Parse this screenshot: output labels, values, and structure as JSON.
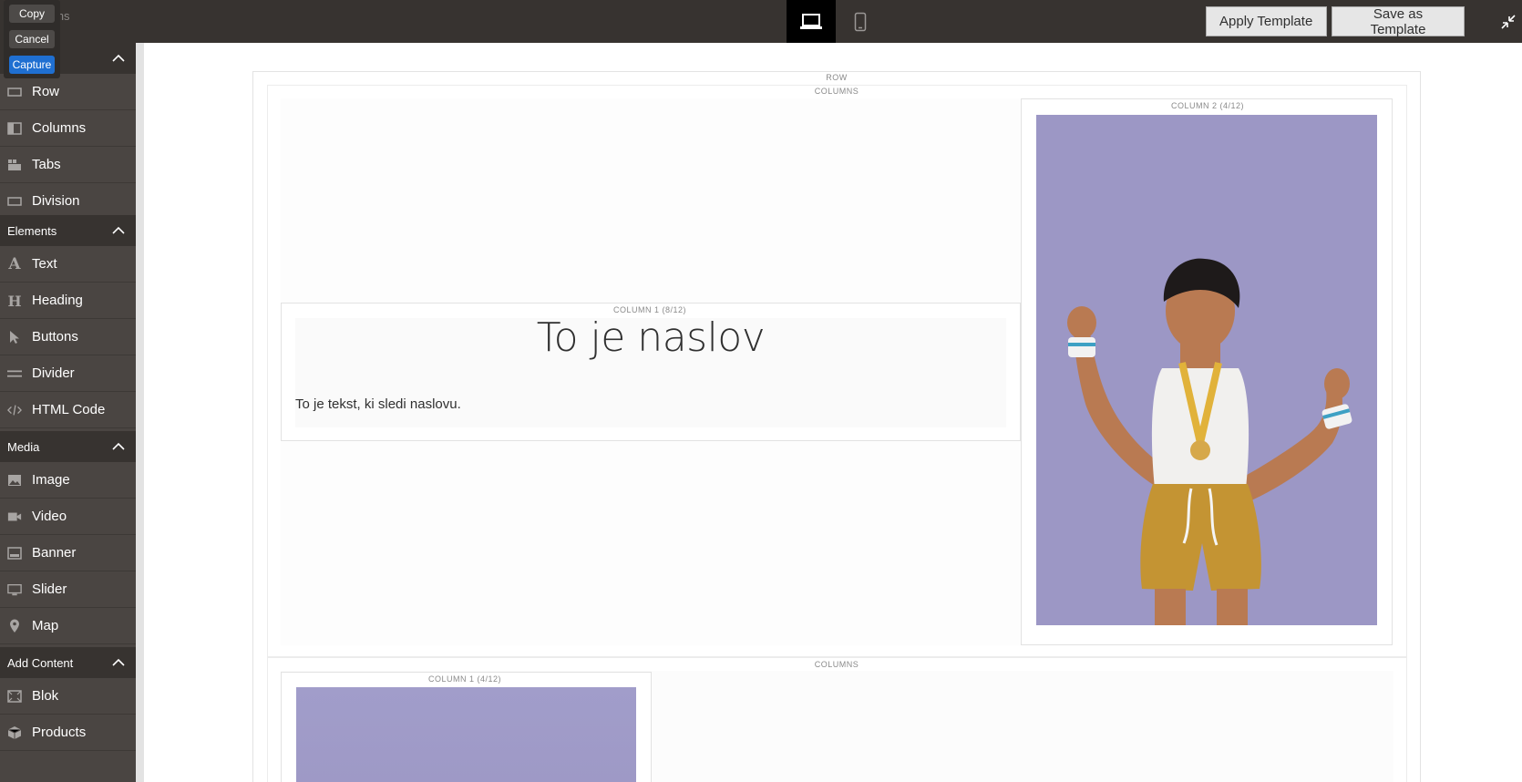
{
  "toolbar": {
    "apply_template": "Apply Template",
    "save_as_template": "Save as Template"
  },
  "capture_widget": {
    "copy": "Copy",
    "cancel": "Cancel",
    "capture": "Capture"
  },
  "sidebar": {
    "search_hint": "ems",
    "groups": [
      {
        "label": ""
      },
      {
        "label": "Elements"
      },
      {
        "label": "Media"
      },
      {
        "label": "Add Content"
      }
    ],
    "layout_items": [
      "Row",
      "Columns",
      "Tabs",
      "Division"
    ],
    "element_items": [
      "Text",
      "Heading",
      "Buttons",
      "Divider",
      "HTML Code"
    ],
    "media_items": [
      "Image",
      "Video",
      "Banner",
      "Slider",
      "Map"
    ],
    "content_items": [
      "Blok",
      "Products"
    ]
  },
  "stage": {
    "row_label": "ROW",
    "columns_label": "COLUMNS",
    "column2_label": "COLUMN 2 (4/12)",
    "column1_label": "COLUMN 1 (8/12)",
    "heading": "To je naslov",
    "text": "To je tekst, ki sledi naslovu.",
    "columns2_label": "COLUMNS",
    "column1b_label": "COLUMN 1 (4/12)"
  },
  "colors": {
    "topbar": "#373330",
    "sidebar": "#4a4542",
    "capture_blue": "#1f6fd1",
    "image_bg": "#9b96c6"
  }
}
